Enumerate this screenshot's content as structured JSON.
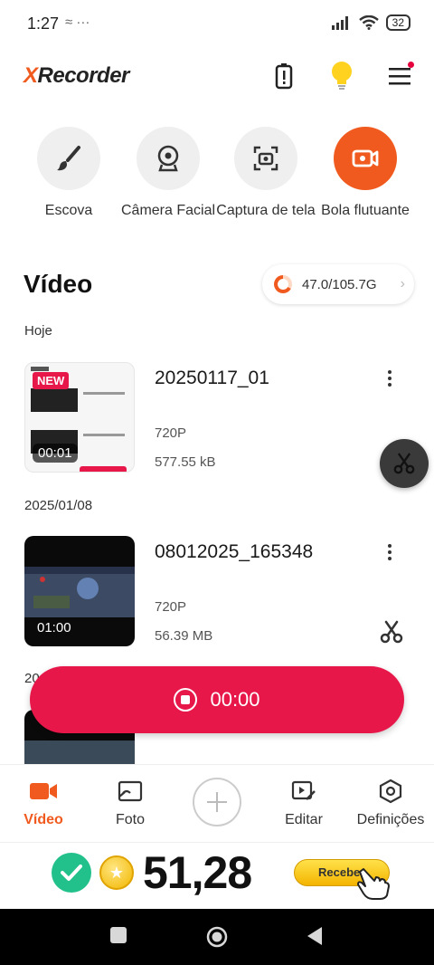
{
  "status_bar": {
    "time": "1:27",
    "left_icons": "≈ ···",
    "battery": "32"
  },
  "header": {
    "logo_x": "X",
    "logo_rest": "Recorder"
  },
  "tools": [
    {
      "label": "Escova",
      "icon": "brush-icon"
    },
    {
      "label": "Câmera Facial",
      "icon": "webcam-icon"
    },
    {
      "label": "Captura de tela",
      "icon": "screenshot-icon"
    },
    {
      "label": "Bola flutuante",
      "icon": "floating-ball-icon"
    }
  ],
  "section": {
    "title": "Vídeo",
    "storage": "47.0/105.7G"
  },
  "groups": [
    {
      "label": "Hoje"
    },
    {
      "label": "2025/01/08"
    },
    {
      "label": "20"
    }
  ],
  "videos": [
    {
      "name": "20250117_01",
      "resolution": "720P",
      "size": "577.55 kB",
      "duration": "00:01",
      "badge": "NEW"
    },
    {
      "name": "08012025_165348",
      "resolution": "720P",
      "size": "56.39 MB",
      "duration": "01:00"
    }
  ],
  "record": {
    "time": "00:00"
  },
  "bottom_nav": [
    {
      "label": "Vídeo",
      "icon": "video-camera-icon",
      "active": true
    },
    {
      "label": "Foto",
      "icon": "photo-icon"
    },
    {
      "label": "Editar",
      "icon": "edit-video-icon"
    },
    {
      "label": "Definições",
      "icon": "settings-hexagon-icon"
    }
  ],
  "reward": {
    "amount": "51,28",
    "button": "Recebe"
  },
  "colors": {
    "accent": "#f05a1e",
    "record": "#e8174a",
    "check": "#22c08a"
  }
}
